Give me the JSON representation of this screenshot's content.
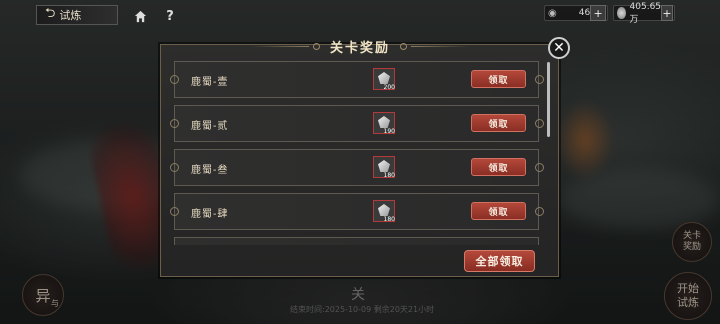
{
  "top_bar": {
    "back_label": "试炼",
    "home_icon": "home-icon",
    "help_label": "?",
    "energy_value": "46",
    "currency_value": "405.65万",
    "plus_label": "+"
  },
  "modal": {
    "title": "关卡奖励",
    "close_label": "✕",
    "rows": [
      {
        "name": "鹿蜀-壹",
        "qty": "200",
        "claim_label": "领取"
      },
      {
        "name": "鹿蜀-贰",
        "qty": "190",
        "claim_label": "领取"
      },
      {
        "name": "鹿蜀-叁",
        "qty": "180",
        "claim_label": "领取"
      },
      {
        "name": "鹿蜀-肆",
        "qty": "180",
        "claim_label": "领取"
      }
    ],
    "claim_all_label": "全部领取"
  },
  "background": {
    "left_button_label": "异",
    "left_button_sub": "与",
    "right_reward_label": "关卡奖励",
    "start_label": "开始试炼",
    "bottom_char": "关",
    "bottom_text": "结束时间:2025-10-09 剩余20天21小时"
  },
  "colors": {
    "accent_red": "#b3483a",
    "frame_gold": "#8a7a5e"
  }
}
